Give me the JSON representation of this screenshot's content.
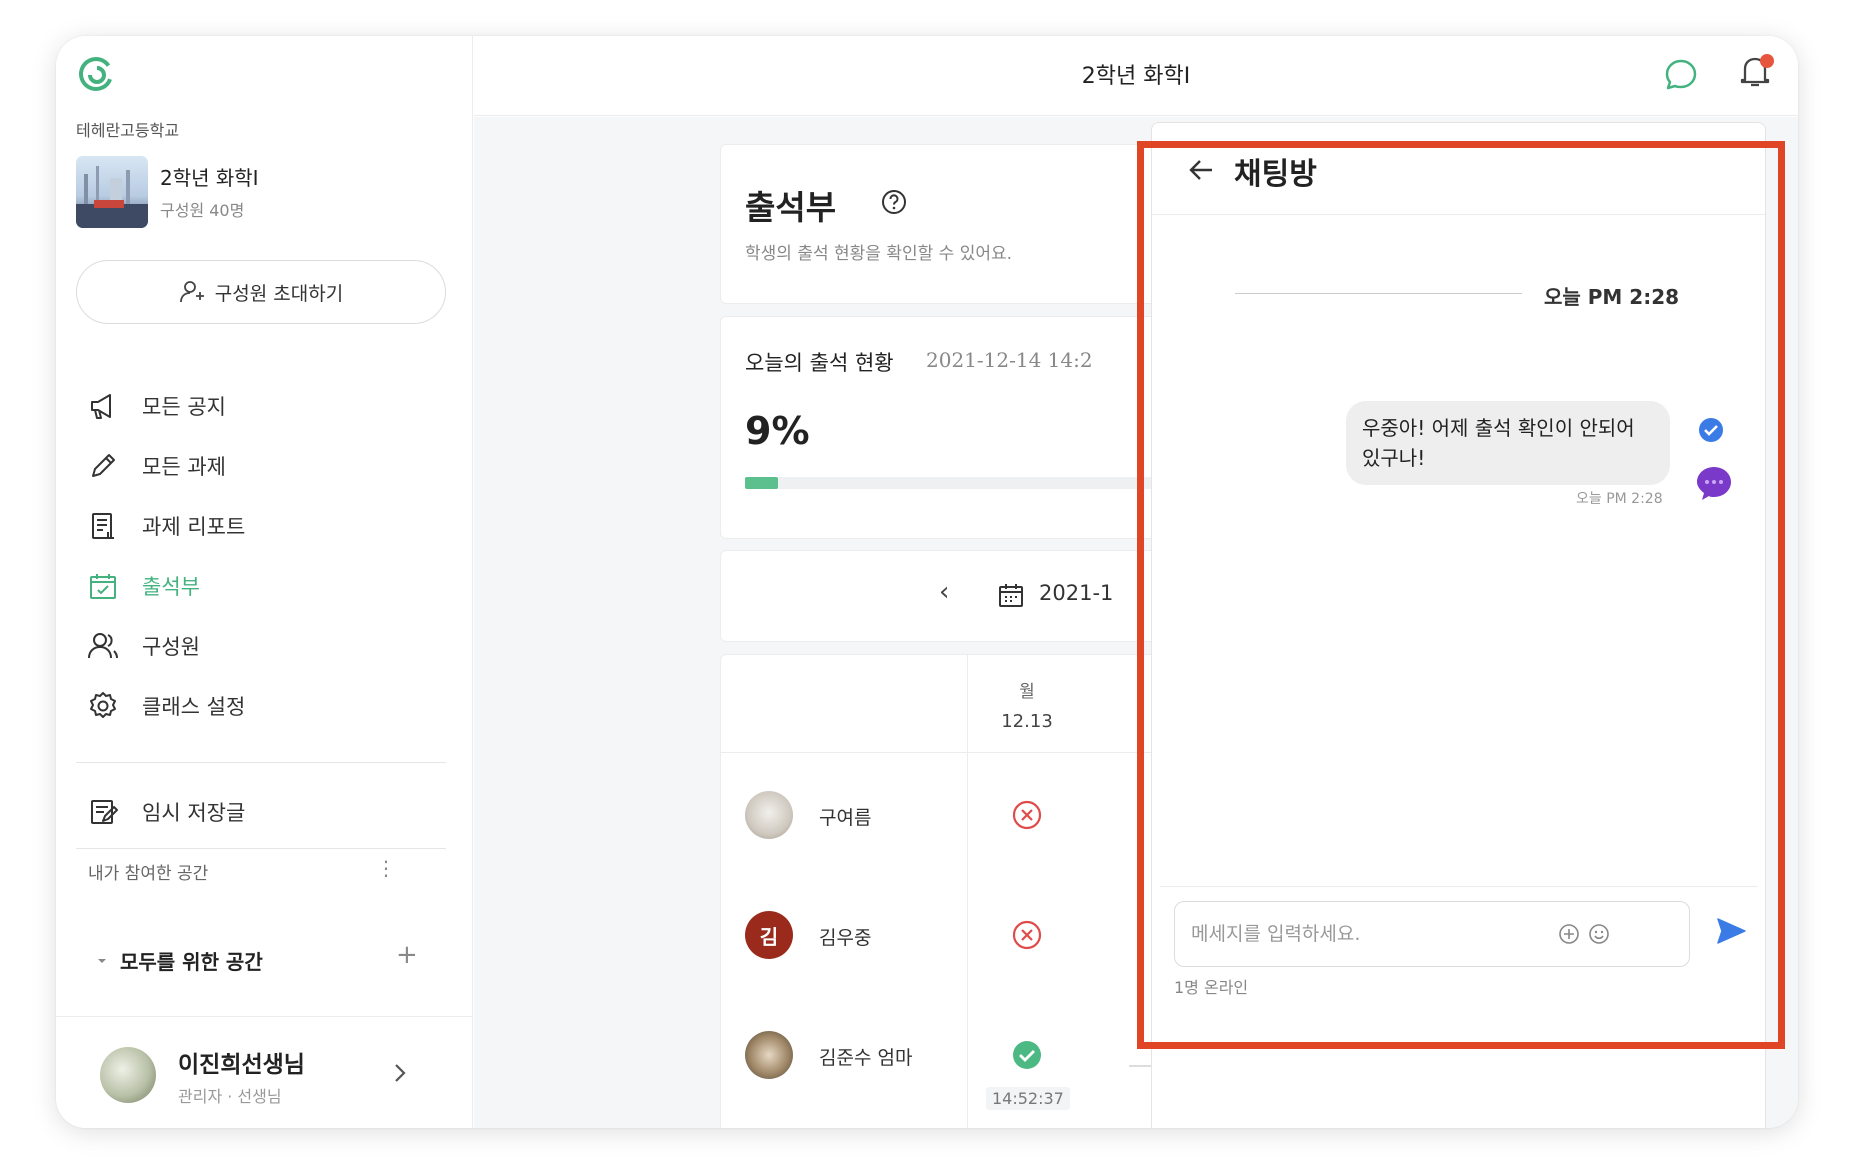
{
  "app": {
    "accent_color": "#43b27f",
    "highlight_color": "#e04626"
  },
  "sidebar": {
    "school_name": "테헤란고등학교",
    "class_name": "2학년 화학I",
    "class_members": "구성원 40명",
    "invite_label": "구성원 초대하기",
    "nav": [
      {
        "label": "모든 공지",
        "icon": "megaphone-icon"
      },
      {
        "label": "모든 과제",
        "icon": "pencil-icon"
      },
      {
        "label": "과제 리포트",
        "icon": "report-icon"
      },
      {
        "label": "출석부",
        "icon": "calendar-check-icon",
        "active": true
      },
      {
        "label": "구성원",
        "icon": "members-icon"
      },
      {
        "label": "클래스 설정",
        "icon": "gear-icon"
      }
    ],
    "temp_label": "임시 저장글",
    "spaces_title": "내가 참여한 공간",
    "spaces_more": "⋮",
    "space_name": "모두를 위한 공간",
    "space_add": "+",
    "user_name": "이진희선생님",
    "user_role": "관리자 · 선생님"
  },
  "topbar": {
    "title": "2학년 화학I"
  },
  "attendance": {
    "title": "출석부",
    "description": "학생의 출석 현황을 확인할 수 있어요.",
    "today_label": "오늘의 출석 현황",
    "today_time": "2021-12-14 14:2",
    "today_time_cut": "",
    "percent": "9%",
    "progress": 0.05,
    "date_text": "2021-1",
    "prev_label": "‹",
    "day_name": "월",
    "day_date": "12.13",
    "students": [
      {
        "name": "구여름",
        "status": "absent",
        "time": ""
      },
      {
        "name": "김우중",
        "status": "absent",
        "initial": "김",
        "time": ""
      },
      {
        "name": "김준수 엄마",
        "status": "present",
        "time": "14:52:37"
      }
    ]
  },
  "chat": {
    "title": "채팅방",
    "time_separator": "오늘 PM 2:28",
    "message_text": "우중아! 어제 출석 확인이 안되어 있구나!",
    "message_time": "오늘 PM 2:28",
    "input_placeholder": "메세지를 입력하세요.",
    "online_status": "1명 온라인"
  }
}
